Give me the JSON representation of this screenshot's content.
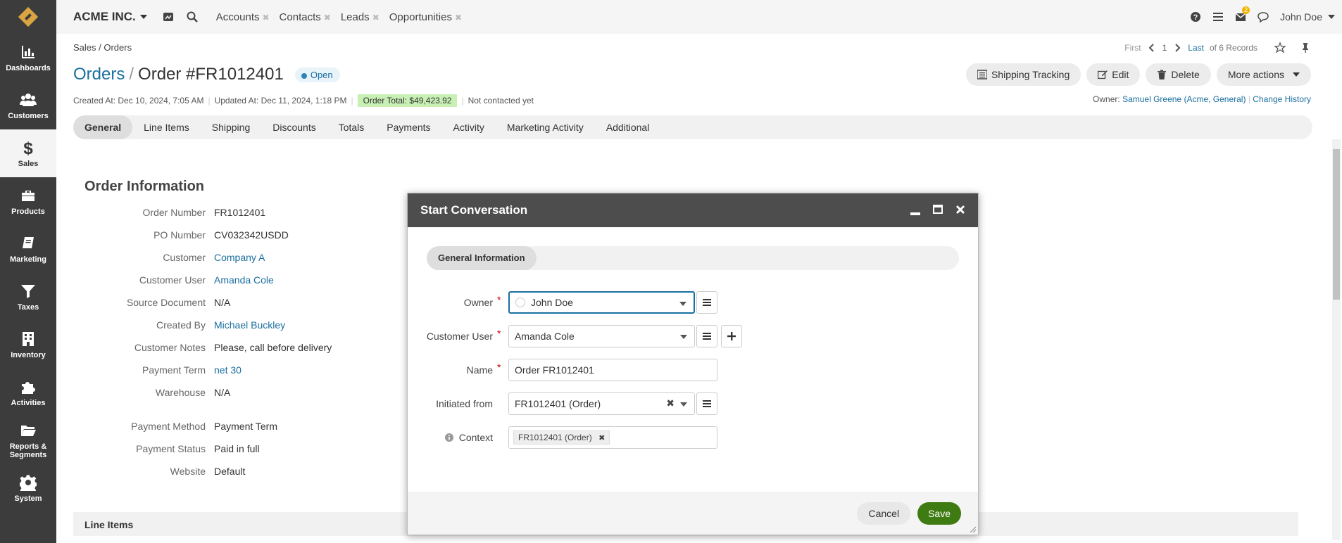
{
  "app": {
    "brand": "ACME INC."
  },
  "top_tabs": [
    {
      "label": "Accounts"
    },
    {
      "label": "Contacts"
    },
    {
      "label": "Leads"
    },
    {
      "label": "Opportunities"
    }
  ],
  "user": {
    "name": "John Doe",
    "notification_count": "2"
  },
  "sidebar": {
    "items": [
      {
        "label": "Dashboards",
        "icon": "bar-chart-icon"
      },
      {
        "label": "Customers",
        "icon": "users-icon"
      },
      {
        "label": "Sales",
        "icon": "dollar-icon"
      },
      {
        "label": "Products",
        "icon": "briefcase-icon"
      },
      {
        "label": "Marketing",
        "icon": "book-icon"
      },
      {
        "label": "Taxes",
        "icon": "filter-icon"
      },
      {
        "label": "Inventory",
        "icon": "building-icon"
      },
      {
        "label": "Activities",
        "icon": "puzzle-icon"
      },
      {
        "label": "Reports & Segments",
        "icon": "folder-icon"
      },
      {
        "label": "System",
        "icon": "gear-icon"
      }
    ]
  },
  "breadcrumb": "Sales / Orders",
  "pager": {
    "first": "First",
    "page": "1",
    "last": "Last",
    "records": "of 6 Records"
  },
  "title": {
    "link": "Orders",
    "sep": "/",
    "text": "Order #FR1012401",
    "status": "Open"
  },
  "actions": {
    "shipping": "Shipping Tracking",
    "edit": "Edit",
    "delete": "Delete",
    "more": "More actions"
  },
  "meta": {
    "created": "Created At: Dec 10, 2024, 7:05 AM",
    "updated": "Updated At: Dec 11, 2024, 1:18 PM",
    "total": "Order Total: $49,423.92",
    "contact": "Not contacted yet",
    "owner_label": "Owner:",
    "owner": "Samuel Greene (Acme, General)",
    "history": "Change History"
  },
  "tabs": [
    {
      "label": "General"
    },
    {
      "label": "Line Items"
    },
    {
      "label": "Shipping"
    },
    {
      "label": "Discounts"
    },
    {
      "label": "Totals"
    },
    {
      "label": "Payments"
    },
    {
      "label": "Activity"
    },
    {
      "label": "Marketing Activity"
    },
    {
      "label": "Additional"
    }
  ],
  "order_info": {
    "heading": "Order Information",
    "rows": [
      {
        "label": "Order Number",
        "value": "FR1012401"
      },
      {
        "label": "PO Number",
        "value": "CV032342USDD"
      },
      {
        "label": "Customer",
        "value": "Company A"
      },
      {
        "label": "Customer User",
        "value": "Amanda Cole"
      },
      {
        "label": "Source Document",
        "value": "N/A"
      },
      {
        "label": "Created By",
        "value": "Michael Buckley"
      },
      {
        "label": "Customer Notes",
        "value": "Please, call before delivery"
      },
      {
        "label": "Payment Term",
        "value": "net 30"
      },
      {
        "label": "Warehouse",
        "value": "N/A"
      },
      {
        "label": "Payment Method",
        "value": "Payment Term"
      },
      {
        "label": "Payment Status",
        "value": "Paid in full"
      },
      {
        "label": "Website",
        "value": "Default"
      }
    ]
  },
  "line_items_heading": "Line Items",
  "dialog": {
    "title": "Start Conversation",
    "section": "General Information",
    "owner_label": "Owner",
    "owner_value": "John Doe",
    "customer_user_label": "Customer User",
    "customer_user_value": "Amanda Cole",
    "name_label": "Name",
    "name_value": "Order FR1012401",
    "initiated_label": "Initiated from",
    "initiated_value": "FR1012401 (Order)",
    "context_label": "Context",
    "context_tag": "FR1012401 (Order)",
    "cancel": "Cancel",
    "save": "Save"
  },
  "colors": {
    "link": "#1a6fa0",
    "save": "#3e7b12",
    "sidebar": "#3c3c3c",
    "total_bg": "#c8f0b4"
  }
}
